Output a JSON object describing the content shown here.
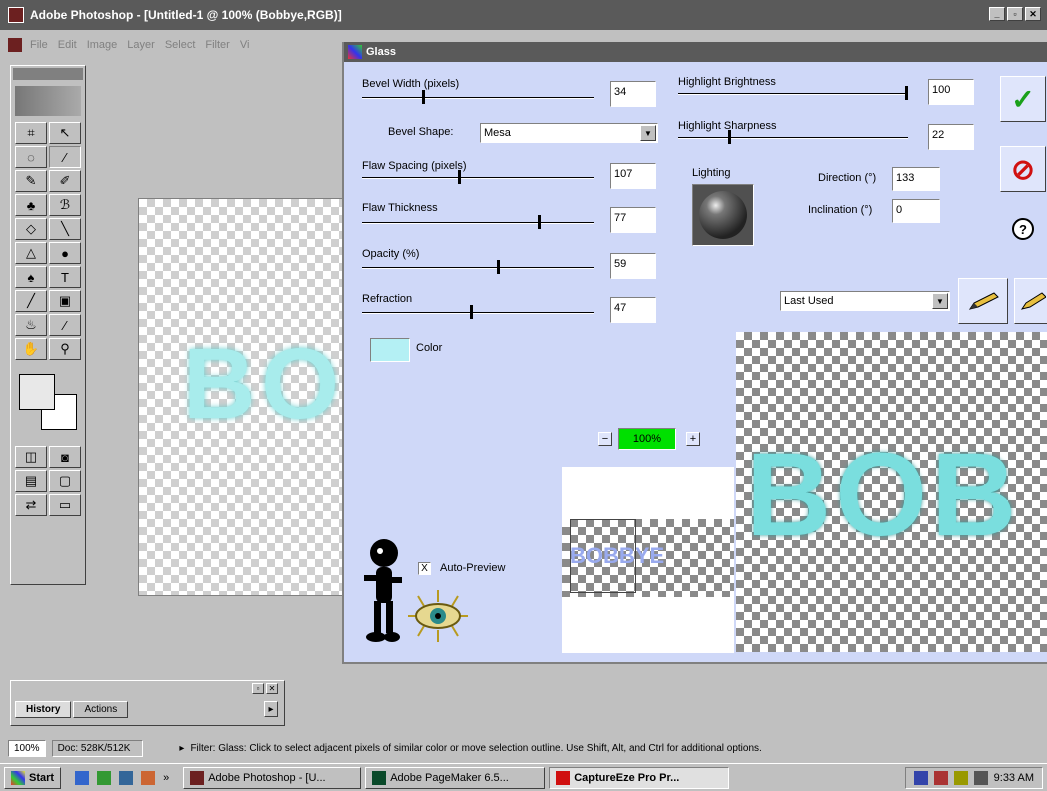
{
  "window": {
    "title": "Adobe Photoshop - [Untitled-1 @ 100% (Bobbye,RGB)]",
    "btn_min": "_",
    "btn_max": "▫",
    "btn_close": "✕"
  },
  "menu": [
    "File",
    "Edit",
    "Image",
    "Layer",
    "Select",
    "Filter",
    "Vi"
  ],
  "doc_text": "BO",
  "history_tabs": [
    "History",
    "Actions"
  ],
  "history_arrow": "▸",
  "status": {
    "zoom": "100%",
    "doc": "Doc: 528K/512K",
    "arrow": "▸",
    "hint": "Filter: Glass:  Click to select adjacent pixels of similar color or move selection outline.  Use Shift, Alt, and Ctrl for additional options."
  },
  "taskbar": {
    "start": "Start",
    "quick_more": "»",
    "tasks": [
      "Adobe Photoshop - [U...",
      "Adobe PageMaker 6.5...",
      "CaptureEze Pro Pr..."
    ],
    "clock": "9:33 AM"
  },
  "dialog": {
    "title": "Glass",
    "bevel_width_label": "Bevel Width (pixels)",
    "bevel_width_value": "34",
    "bevel_shape_label": "Bevel Shape:",
    "bevel_shape_value": "Mesa",
    "flaw_spacing_label": "Flaw Spacing (pixels)",
    "flaw_spacing_value": "107",
    "flaw_thickness_label": "Flaw Thickness",
    "flaw_thickness_value": "77",
    "opacity_label": "Opacity (%)",
    "opacity_value": "59",
    "refraction_label": "Refraction",
    "refraction_value": "47",
    "color_label": "Color",
    "highlight_brightness_label": "Highlight Brightness",
    "highlight_brightness_value": "100",
    "highlight_sharpness_label": "Highlight Sharpness",
    "highlight_sharpness_value": "22",
    "lighting_label": "Lighting",
    "direction_label": "Direction (°)",
    "direction_value": "133",
    "inclination_label": "Inclination (°)",
    "inclination_value": "0",
    "ok_glyph": "✓",
    "cancel_glyph": "⊘",
    "help_glyph": "?",
    "preset_value": "Last Used",
    "zoom_value": "100%",
    "zoom_minus": "−",
    "zoom_plus": "+",
    "auto_preview_label": "Auto-Preview",
    "auto_preview_checked": "X",
    "preview_large_text": "BOB",
    "preview_small_text": "BOBBYE"
  },
  "sliders": {
    "bevel_width": 0.26,
    "flaw_spacing": 0.42,
    "flaw_thickness": 0.77,
    "opacity": 0.59,
    "refraction": 0.47,
    "highlight_brightness": 1.0,
    "highlight_sharpness": 0.22
  },
  "colors": {
    "glass_color": "#b4f0f4",
    "dialog_bg": "#cfd8f8",
    "zoom_bg": "#00e000",
    "ok": "#1aa01a",
    "cancel": "#d01010"
  },
  "icons": {
    "ok": "check-icon",
    "cancel": "cancel-icon",
    "help": "help-icon",
    "lighting": "lighting-sphere-icon",
    "mascot": "figure-icon",
    "eye": "eye-icon",
    "pencil": "pencil-icon"
  }
}
